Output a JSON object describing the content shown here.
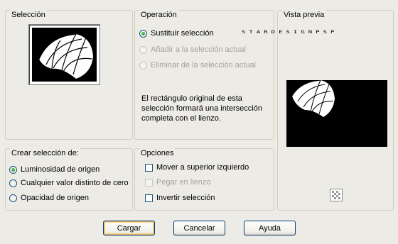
{
  "seleccion": {
    "legend": "Selección"
  },
  "operacion": {
    "legend": "Operación",
    "options": [
      {
        "label": "Sustituir selección",
        "checked": true,
        "enabled": true
      },
      {
        "label": "Añadir a la selección actual",
        "checked": false,
        "enabled": false
      },
      {
        "label": "Eliminar de la selección actual",
        "checked": false,
        "enabled": false
      }
    ],
    "description": [
      "El rectángulo original de esta",
      "selección formará una intersección",
      "completa con el lienzo."
    ]
  },
  "watermark": "STARDESIGNPSP",
  "vista_previa": {
    "legend": "Vista previa",
    "transparency_icon": "checkerboard-icon"
  },
  "crear": {
    "legend": "Crear selección de:",
    "options": [
      {
        "label": "Luminosidad de origen",
        "checked": true
      },
      {
        "label": "Cualquier valor distinto de cero",
        "checked": false
      },
      {
        "label": "Opacidad de origen",
        "checked": false
      }
    ]
  },
  "opciones": {
    "legend": "Opciones",
    "items": [
      {
        "label": "Mover a superior izquierdo",
        "checked": false,
        "enabled": true
      },
      {
        "label": "Pegar en lienzo",
        "checked": false,
        "enabled": false
      },
      {
        "label": "Invertir selección",
        "checked": false,
        "enabled": true
      }
    ]
  },
  "buttons": {
    "cargar": "Cargar",
    "cancelar": "Cancelar",
    "ayuda": "Ayuda"
  },
  "colors": {
    "radio_checked": "#21a121",
    "button_border": "#003c74",
    "default_highlight": "#e6b35e"
  }
}
